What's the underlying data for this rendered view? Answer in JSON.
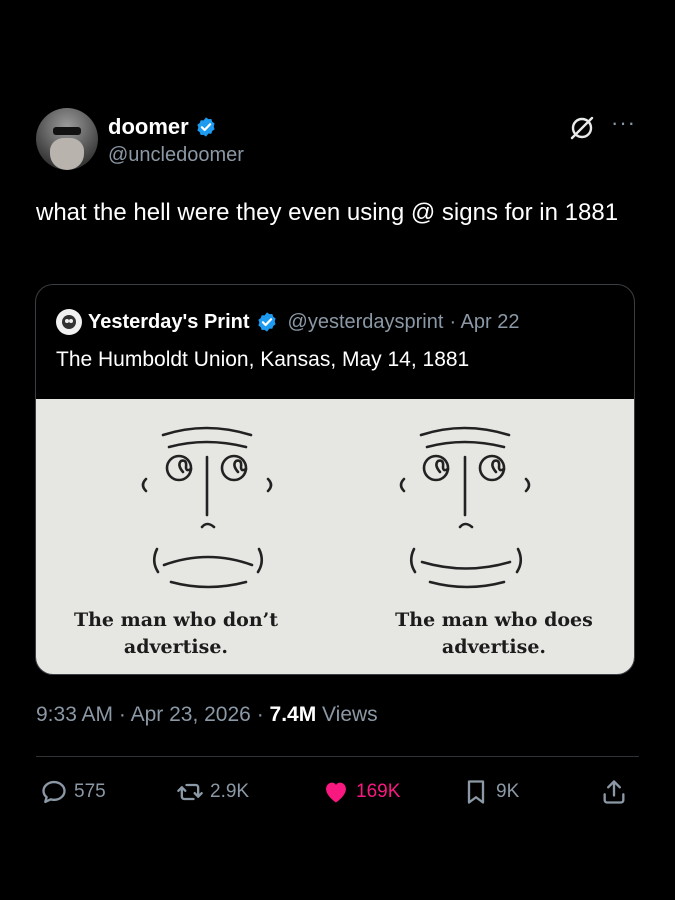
{
  "post": {
    "display_name": "doomer",
    "handle": "@uncledoomer",
    "text": "what the hell were they even using @ signs for in 1881",
    "time": "9:33 AM",
    "date": "Apr 23, 2026",
    "views_count": "7.4M",
    "views_label": "Views",
    "more_label": "···"
  },
  "quote": {
    "display_name": "Yesterday's Print",
    "handle": "@yesterdaysprint",
    "date": "· Apr 22",
    "text": "The Humboldt Union, Kansas, May 14, 1881",
    "caption_left_1": "The man who don’t",
    "caption_left_2": "advertise.",
    "caption_right_1": "The man who does",
    "caption_right_2": "advertise."
  },
  "actions": {
    "replies": "575",
    "reposts": "2.9K",
    "likes": "169K",
    "bookmarks": "9K"
  },
  "colors": {
    "accent": "#1d9bf0",
    "like": "#f91880",
    "muted": "#8b98a5",
    "background": "#000000"
  }
}
